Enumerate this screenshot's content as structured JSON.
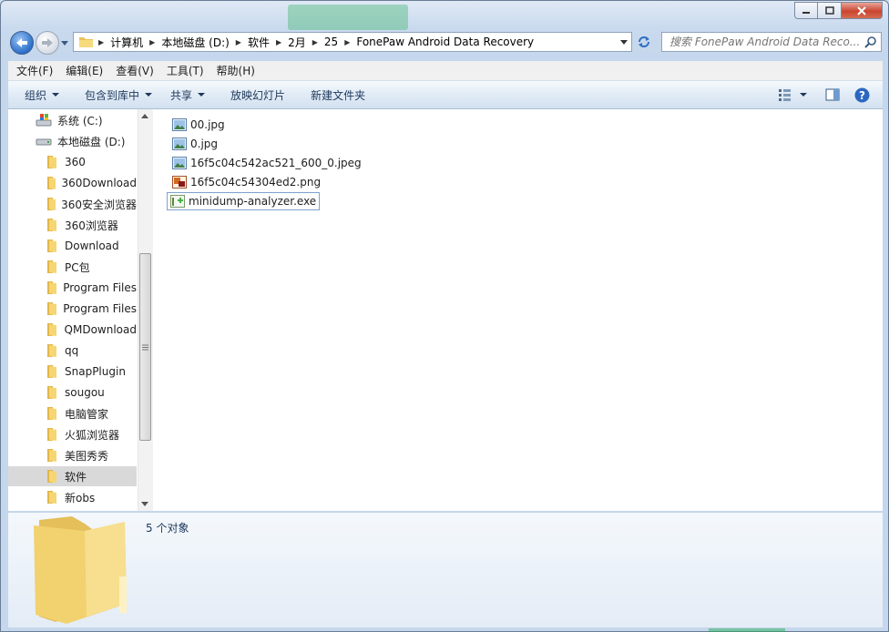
{
  "window": {
    "controls": {
      "minimize_icon": "minimize-icon",
      "maximize_icon": "maximize-icon",
      "close_icon": "close-icon"
    }
  },
  "navigation": {
    "breadcrumbs": [
      "计算机",
      "本地磁盘 (D:)",
      "软件",
      "2月",
      "25",
      "FonePaw Android Data Recovery"
    ],
    "search_placeholder": "搜索 FonePaw Android Data Reco..."
  },
  "menu": [
    "文件(F)",
    "编辑(E)",
    "查看(V)",
    "工具(T)",
    "帮助(H)"
  ],
  "commands": {
    "organize": "组织",
    "include_in_library": "包含到库中",
    "share": "共享",
    "slideshow": "放映幻灯片",
    "new_folder": "新建文件夹"
  },
  "tree": [
    {
      "label": "系统 (C:)",
      "type": "drive-system"
    },
    {
      "label": "本地磁盘 (D:)",
      "type": "drive"
    },
    {
      "label": "360",
      "type": "folder"
    },
    {
      "label": "360Download",
      "type": "folder"
    },
    {
      "label": "360安全浏览器",
      "type": "folder"
    },
    {
      "label": "360浏览器",
      "type": "folder"
    },
    {
      "label": "Download",
      "type": "folder"
    },
    {
      "label": "PC包",
      "type": "folder"
    },
    {
      "label": "Program Files",
      "type": "folder"
    },
    {
      "label": "Program Files",
      "type": "folder"
    },
    {
      "label": "QMDownload",
      "type": "folder"
    },
    {
      "label": "qq",
      "type": "folder"
    },
    {
      "label": "SnapPlugin",
      "type": "folder"
    },
    {
      "label": "sougou",
      "type": "folder"
    },
    {
      "label": "电脑管家",
      "type": "folder"
    },
    {
      "label": "火狐浏览器",
      "type": "folder"
    },
    {
      "label": "美图秀秀",
      "type": "folder"
    },
    {
      "label": "软件",
      "type": "folder",
      "selected": true
    },
    {
      "label": "新obs",
      "type": "folder"
    }
  ],
  "files": [
    {
      "name": "00.jpg",
      "icon": "image-file-icon"
    },
    {
      "name": "0.jpg",
      "icon": "image-file-icon"
    },
    {
      "name": "16f5c04c542ac521_600_0.jpeg",
      "icon": "image-file-icon"
    },
    {
      "name": "16f5c04c54304ed2.png",
      "icon": "png-file-icon"
    },
    {
      "name": "minidump-analyzer.exe",
      "icon": "exe-file-icon",
      "focused": true
    }
  ],
  "details": {
    "count": "5 个对象"
  },
  "colors": {
    "accent": "#1e395b",
    "selection": "#d9d9d9",
    "folder": "#f2d06b"
  }
}
